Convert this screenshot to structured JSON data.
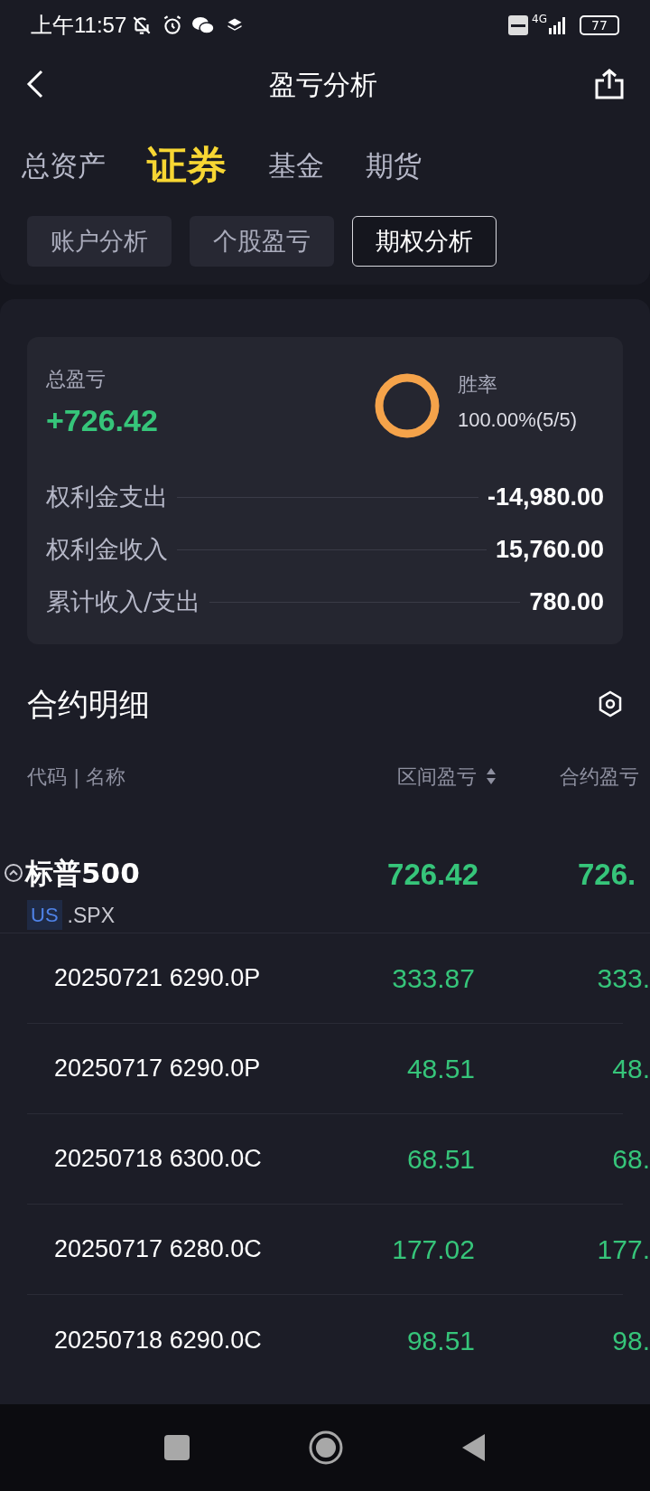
{
  "status_bar": {
    "time": "上午11:57",
    "network": "4G",
    "battery": "77"
  },
  "header": {
    "title": "盈亏分析"
  },
  "tabs": [
    {
      "label": "总资产",
      "selected": false
    },
    {
      "label": "证券",
      "selected": true
    },
    {
      "label": "基金",
      "selected": false
    },
    {
      "label": "期货",
      "selected": false
    }
  ],
  "sub_tabs": [
    {
      "label": "账户分析",
      "selected": false
    },
    {
      "label": "个股盈亏",
      "selected": false
    },
    {
      "label": "期权分析",
      "selected": true
    }
  ],
  "summary": {
    "total_label": "总盈亏",
    "total_value": "+726.42",
    "win_label": "胜率",
    "win_value": "100.00%(5/5)",
    "rows": [
      {
        "label": "权利金支出",
        "value": "-14,980.00"
      },
      {
        "label": "权利金收入",
        "value": "15,760.00"
      },
      {
        "label": "累计收入/支出",
        "value": "780.00"
      }
    ]
  },
  "details": {
    "title": "合约明细",
    "columns": [
      "代码 | 名称",
      "区间盈亏",
      "合约盈亏"
    ],
    "group": {
      "name": "标普500",
      "market": "US",
      "code": ".SPX",
      "expanded": true,
      "period_pnl": "726.42",
      "contract_pnl": "726."
    },
    "rows": [
      {
        "name": "20250721 6290.0P",
        "period_pnl": "333.87",
        "contract_pnl": "333."
      },
      {
        "name": "20250717 6290.0P",
        "period_pnl": "48.51",
        "contract_pnl": "48."
      },
      {
        "name": "20250718 6300.0C",
        "period_pnl": "68.51",
        "contract_pnl": "68."
      },
      {
        "name": "20250717 6280.0C",
        "period_pnl": "177.02",
        "contract_pnl": "177."
      },
      {
        "name": "20250718 6290.0C",
        "period_pnl": "98.51",
        "contract_pnl": "98."
      }
    ]
  }
}
